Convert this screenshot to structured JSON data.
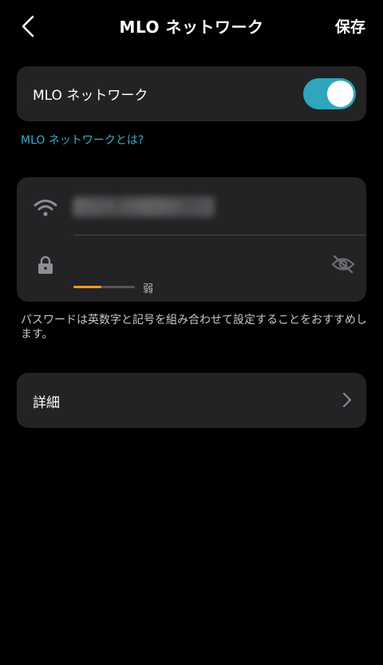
{
  "header": {
    "title": "MLO ネットワーク",
    "save_label": "保存"
  },
  "mlo": {
    "label": "MLO ネットワーク",
    "enabled": true,
    "toggle_color": "#2fa6bd"
  },
  "link": {
    "label": "MLO ネットワークとは?"
  },
  "network": {
    "ssid_blurred": "TP-Link_XXXX_MLO",
    "password_value": "",
    "strength_level": 0.45,
    "strength_label": "弱",
    "strength_color": "#f39a1f"
  },
  "hint": {
    "text": "パスワードは英数字と記号を組み合わせて設定することをおすすめします。"
  },
  "detail": {
    "label": "詳細"
  }
}
